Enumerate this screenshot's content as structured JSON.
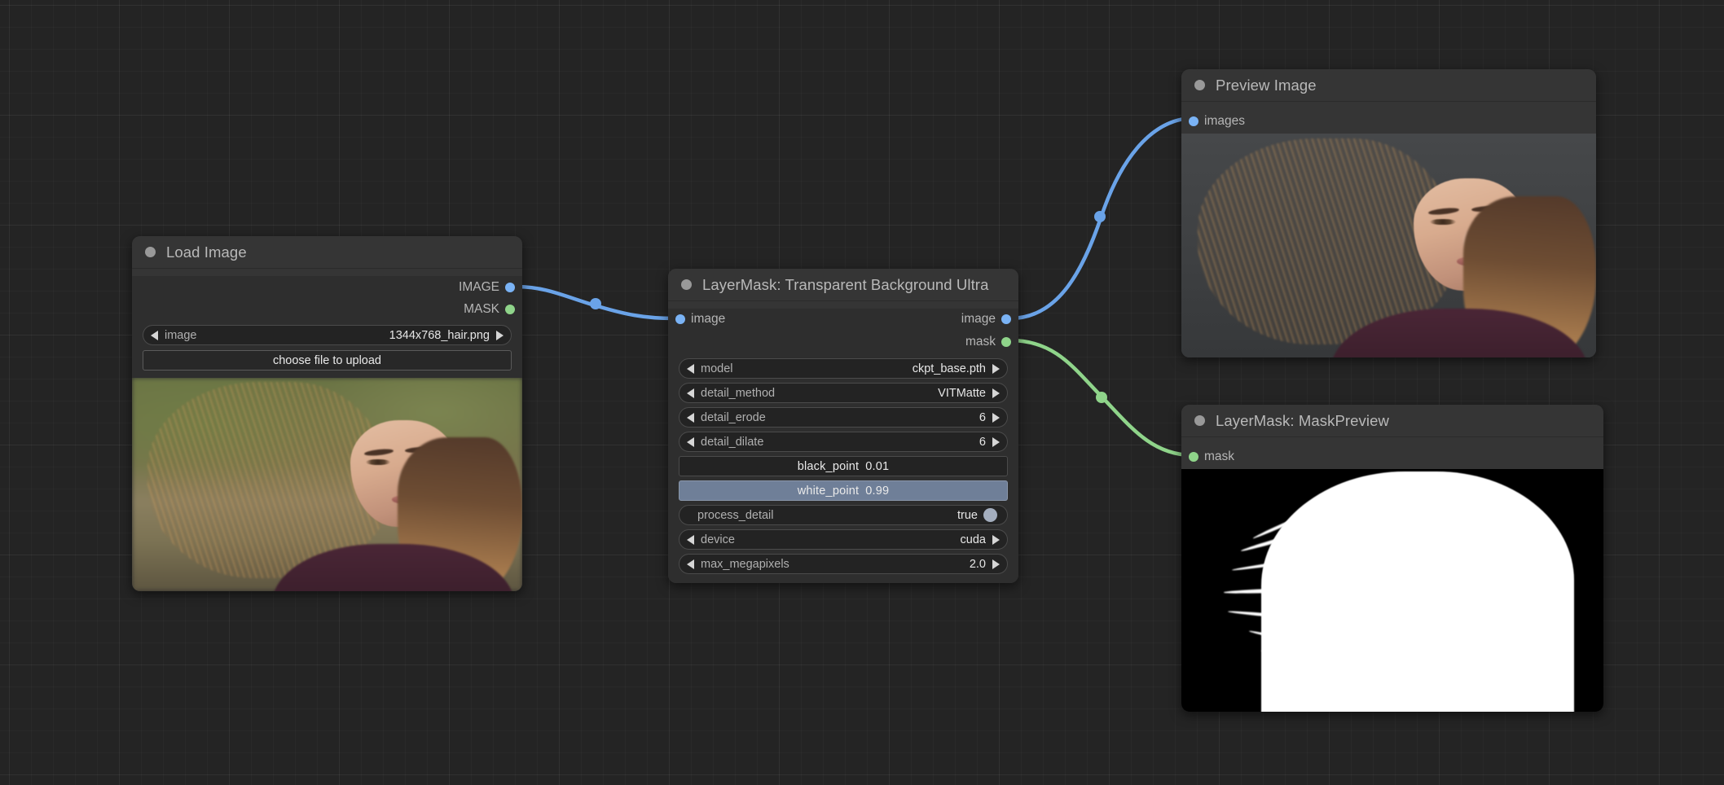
{
  "app": {
    "name": "ComfyUI Node Graph",
    "background_color": "#242424"
  },
  "colors": {
    "node_body": "#2e2e2e",
    "node_title": "#353535",
    "image_port": "#7ab3f5",
    "mask_port": "#8fd48a",
    "image_link": "#6aa3e8",
    "mask_link": "#8fd48a",
    "slider_fill": "#6f7f98",
    "text_primary": "#e6e6e6",
    "text_secondary": "#b0b0b0"
  },
  "nodes": [
    {
      "id": "load-image",
      "title": "Load Image",
      "collapse_icon": "collapse-dot-icon",
      "outputs": [
        {
          "label": "IMAGE",
          "type": "image"
        },
        {
          "label": "MASK",
          "type": "mask"
        }
      ],
      "widgets": [
        {
          "kind": "combo",
          "name": "image",
          "value": "1344x768_hair.png"
        }
      ],
      "button": "choose file to upload",
      "preview": "portrait-photo-outdoor"
    },
    {
      "id": "transparent-background-ultra",
      "title": "LayerMask: Transparent Background Ultra",
      "collapse_icon": "collapse-dot-icon",
      "inputs": [
        {
          "label": "image",
          "type": "image"
        }
      ],
      "outputs": [
        {
          "label": "image",
          "type": "image"
        },
        {
          "label": "mask",
          "type": "mask"
        }
      ],
      "widgets": [
        {
          "kind": "combo",
          "name": "model",
          "value": "ckpt_base.pth"
        },
        {
          "kind": "combo",
          "name": "detail_method",
          "value": "VITMatte"
        },
        {
          "kind": "combo",
          "name": "detail_erode",
          "value": "6"
        },
        {
          "kind": "combo",
          "name": "detail_dilate",
          "value": "6"
        },
        {
          "kind": "slider",
          "name": "black_point",
          "value": "0.01",
          "fill_percent": 0
        },
        {
          "kind": "slider",
          "name": "white_point",
          "value": "0.99",
          "fill_percent": 100
        },
        {
          "kind": "toggle",
          "name": "process_detail",
          "value": "true"
        },
        {
          "kind": "combo",
          "name": "device",
          "value": "cuda"
        },
        {
          "kind": "combo",
          "name": "max_megapixels",
          "value": "2.0"
        }
      ]
    },
    {
      "id": "preview-image",
      "title": "Preview Image",
      "collapse_icon": "collapse-dot-icon",
      "inputs": [
        {
          "label": "images",
          "type": "image"
        }
      ],
      "preview": "portrait-photo-cutout"
    },
    {
      "id": "mask-preview",
      "title": "LayerMask: MaskPreview",
      "collapse_icon": "collapse-dot-icon",
      "inputs": [
        {
          "label": "mask",
          "type": "mask"
        }
      ],
      "preview": "binary-mask-silhouette"
    }
  ],
  "links": [
    {
      "from": "load-image.IMAGE",
      "to": "transparent-background-ultra.image",
      "type": "image"
    },
    {
      "from": "transparent-background-ultra.image",
      "to": "preview-image.images",
      "type": "image"
    },
    {
      "from": "transparent-background-ultra.mask",
      "to": "mask-preview.mask",
      "type": "mask"
    }
  ]
}
